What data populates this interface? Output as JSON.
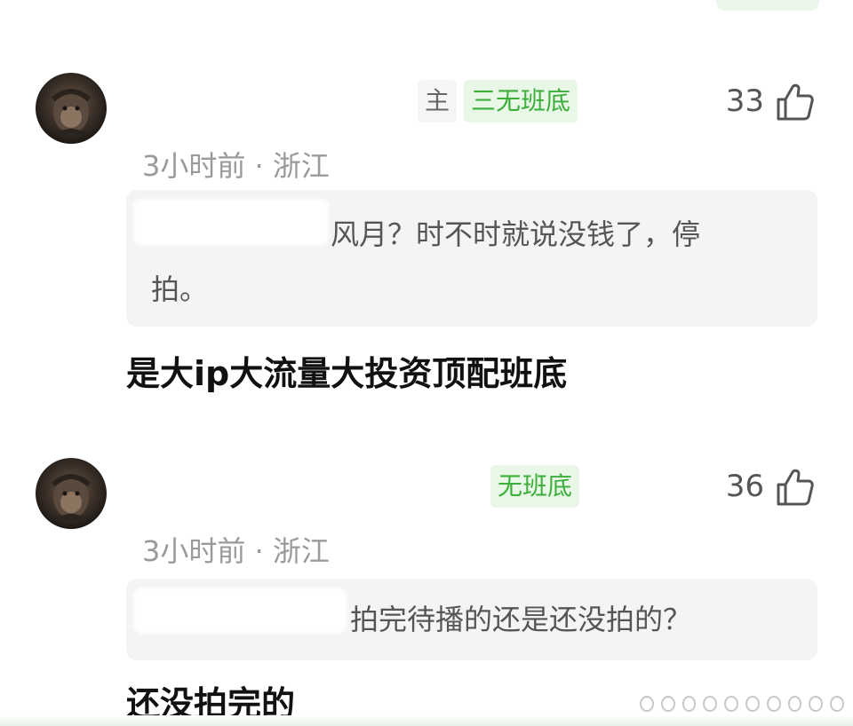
{
  "comments": [
    {
      "tags": [
        "主",
        "三无班底"
      ],
      "likes": "33",
      "meta": "3小时前 · 浙江",
      "quote_line1": "风月？时不时就说没钱了，停",
      "quote_line2": "拍。",
      "reply": "是大ip大流量大投资顶配班底"
    },
    {
      "tags": [
        "无班底"
      ],
      "likes": "36",
      "meta": "3小时前 · 浙江",
      "quote_line1": "拍完待播的还是还没拍的？",
      "reply": "还没拍完的"
    }
  ],
  "colors": {
    "tag_green_bg": "#e8f7e6",
    "tag_green_text": "#3cae3a",
    "quote_bg": "#f4f4f4",
    "meta_text": "#9a9a9a"
  },
  "icons": {
    "like": "thumbs-up-icon",
    "avatar": "monkey-avatar-icon"
  }
}
